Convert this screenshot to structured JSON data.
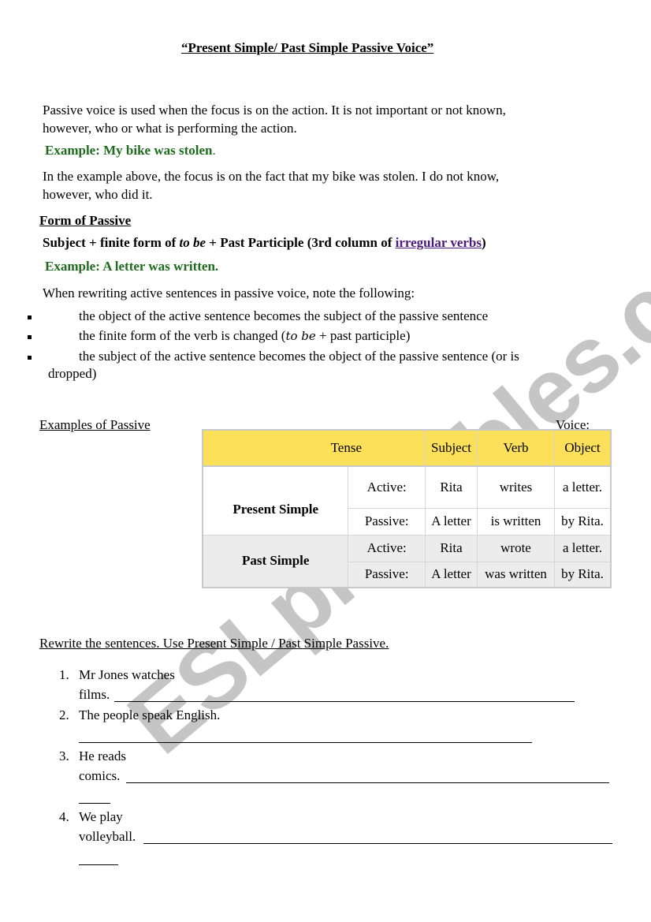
{
  "title": "“Present Simple/ Past Simple Passive Voice”",
  "intro": {
    "line1": "Passive voice is used when the focus is on the action. It is not important or not known,",
    "line2": "however, who or what is performing the action.",
    "example1": "Example: My bike was stolen",
    "example1_end": ".",
    "explain1": "In the example above, the focus is on the fact that my bike was stolen. I do not know,",
    "explain2": "however, who did it."
  },
  "form": {
    "heading": "Form of Passive",
    "formula_a": "Subject + finite form of ",
    "formula_tobe": "to be",
    "formula_b": " + Past Participle (3rd column of ",
    "formula_link": "irregular verbs",
    "formula_c": ")",
    "example2": "Example: A letter was written.",
    "note_intro": "When rewriting active sentences in passive voice, note the following:",
    "bullets": [
      "the object of the active sentence becomes the subject of the passive sentence",
      "the finite form of the verb is changed (",
      "the subject of the active sentence becomes the object of the passive sentence (or is"
    ],
    "bullet2_italic": "to be",
    "bullet2_end": " + past participle)",
    "bullet3_cont": "dropped)"
  },
  "examples": {
    "label_left": "Examples of Passive",
    "label_right": "Voice:",
    "table": {
      "headers": [
        "Tense",
        "Subject",
        "Verb",
        "Object"
      ],
      "rows": [
        {
          "tense": "Present Simple",
          "voice": "Active:",
          "subject": "Rita",
          "verb": "writes",
          "object": "a letter."
        },
        {
          "tense": "",
          "voice": "Passive:",
          "subject": "A letter",
          "verb": "is written",
          "object": "by Rita."
        },
        {
          "tense": "Past Simple",
          "voice": "Active:",
          "subject": "Rita",
          "verb": "wrote",
          "object": "a letter."
        },
        {
          "tense": "",
          "voice": "Passive:",
          "subject": "A letter",
          "verb": "was written",
          "object": "by Rita."
        }
      ]
    }
  },
  "exercise": {
    "instruction": "Rewrite the sentences. Use Present Simple / Past Simple Passive.",
    "items": [
      {
        "num": "1.",
        "line1": "Mr Jones watches",
        "line2": "films."
      },
      {
        "num": "2.",
        "line1": "The people speak English.",
        "line2": ""
      },
      {
        "num": "3.",
        "line1": "He reads",
        "line2": "comics."
      },
      {
        "num": "4.",
        "line1": "We play",
        "line2": "volleyball."
      }
    ]
  },
  "watermark": "ESLprintables.com",
  "colors": {
    "example_green": "#1e6b1e",
    "link_purple": "#4b1a7a",
    "table_header_yellow": "#fde05a",
    "past_row_gray": "#ececec"
  }
}
